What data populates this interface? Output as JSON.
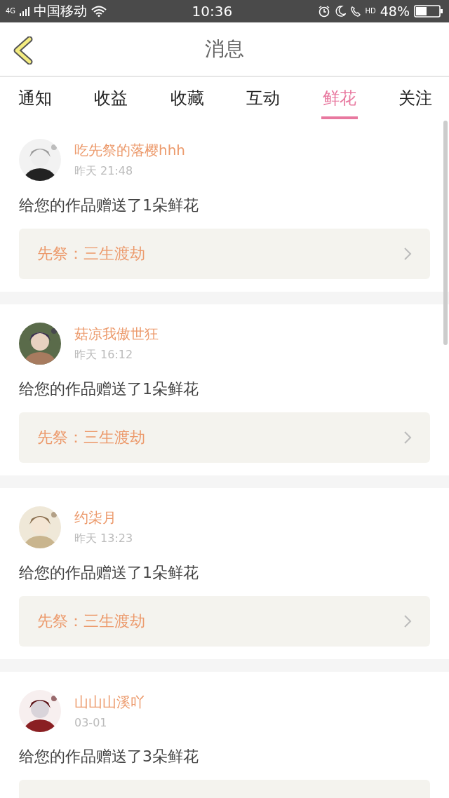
{
  "status_bar": {
    "network": "4G",
    "carrier": "中国移动",
    "time": "10:36",
    "call_badge": "HD",
    "battery": "48%"
  },
  "nav": {
    "title": "消息"
  },
  "tabs": [
    {
      "label": "通知",
      "selected": false
    },
    {
      "label": "收益",
      "selected": false
    },
    {
      "label": "收藏",
      "selected": false
    },
    {
      "label": "互动",
      "selected": false
    },
    {
      "label": "鲜花",
      "selected": true
    },
    {
      "label": "关注",
      "selected": false
    }
  ],
  "messages": [
    {
      "user": "吃先祭的落樱hhh",
      "time": "昨天 21:48",
      "text": "给您的作品赠送了1朵鲜花",
      "work": "先祭：三生渡劫"
    },
    {
      "user": "菇凉我傲世狂",
      "time": "昨天 16:12",
      "text": "给您的作品赠送了1朵鲜花",
      "work": "先祭：三生渡劫"
    },
    {
      "user": "约柒月",
      "time": "昨天 13:23",
      "text": "给您的作品赠送了1朵鲜花",
      "work": "先祭：三生渡劫"
    },
    {
      "user": "山山山溪吖",
      "time": "03-01",
      "text": "给您的作品赠送了3朵鲜花"
    }
  ]
}
